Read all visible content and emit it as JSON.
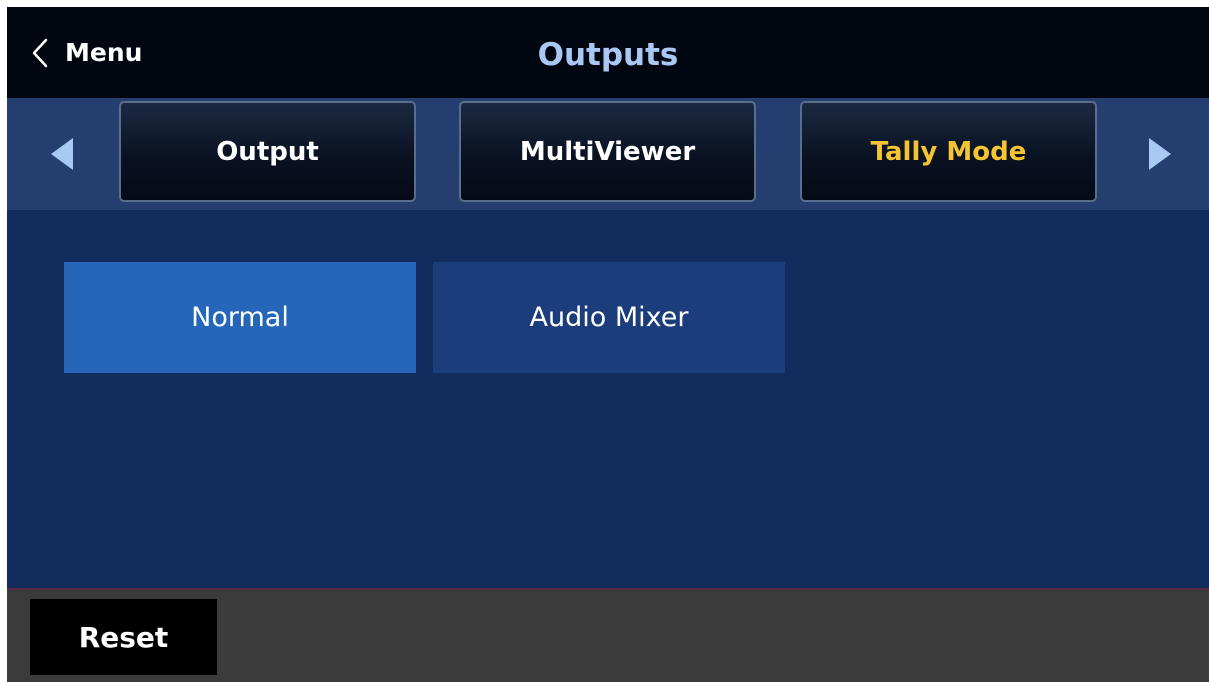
{
  "header": {
    "back_label": "Menu",
    "title": "Outputs"
  },
  "tabs": [
    {
      "label": "Output",
      "selected": false
    },
    {
      "label": "MultiViewer",
      "selected": false
    },
    {
      "label": "Tally Mode",
      "selected": true
    }
  ],
  "options": [
    {
      "label": "Normal",
      "selected": true
    },
    {
      "label": "Audio Mixer",
      "selected": false
    }
  ],
  "footer": {
    "reset_label": "Reset"
  },
  "icons": {
    "back": "chevron-left-icon",
    "prev": "triangle-left-icon",
    "next": "triangle-right-icon"
  },
  "colors": {
    "title": "#a9c8f4",
    "active_tab_text": "#f5c431",
    "selected_option": "#2566b8",
    "unselected_option": "#1b3d7c",
    "content_background": "#132c5e"
  }
}
